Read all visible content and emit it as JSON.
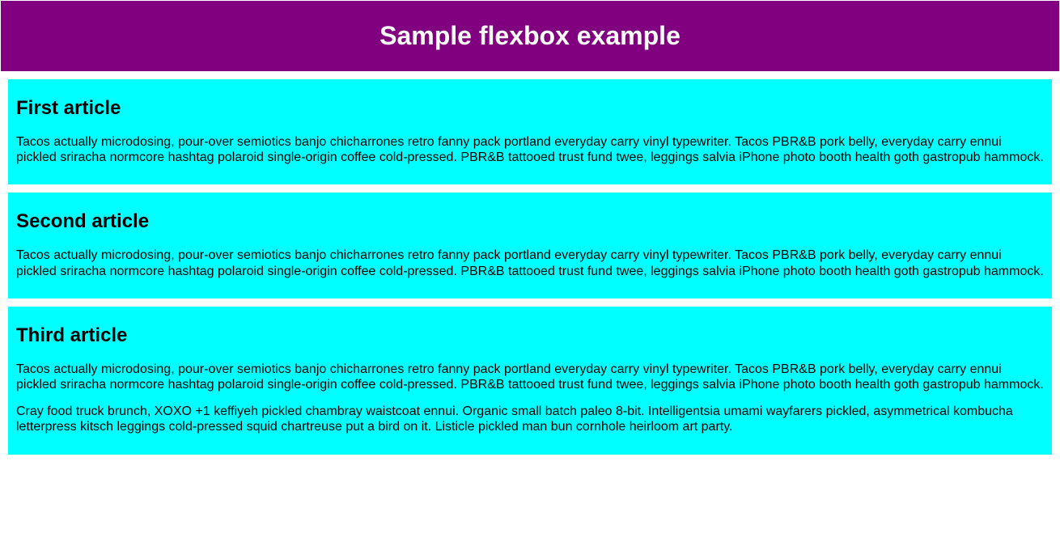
{
  "header": {
    "title": "Sample flexbox example"
  },
  "articles": [
    {
      "title": "First article",
      "paragraphs": [
        "Tacos actually microdosing, pour-over semiotics banjo chicharrones retro fanny pack portland everyday carry vinyl typewriter. Tacos PBR&B pork belly, everyday carry ennui pickled sriracha normcore hashtag polaroid single-origin coffee cold-pressed. PBR&B tattooed trust fund twee, leggings salvia iPhone photo booth health goth gastropub hammock."
      ]
    },
    {
      "title": "Second article",
      "paragraphs": [
        "Tacos actually microdosing, pour-over semiotics banjo chicharrones retro fanny pack portland everyday carry vinyl typewriter. Tacos PBR&B pork belly, everyday carry ennui pickled sriracha normcore hashtag polaroid single-origin coffee cold-pressed. PBR&B tattooed trust fund twee, leggings salvia iPhone photo booth health goth gastropub hammock."
      ]
    },
    {
      "title": "Third article",
      "paragraphs": [
        "Tacos actually microdosing, pour-over semiotics banjo chicharrones retro fanny pack portland everyday carry vinyl typewriter. Tacos PBR&B pork belly, everyday carry ennui pickled sriracha normcore hashtag polaroid single-origin coffee cold-pressed. PBR&B tattooed trust fund twee, leggings salvia iPhone photo booth health goth gastropub hammock.",
        "Cray food truck brunch, XOXO +1 keffiyeh pickled chambray waistcoat ennui. Organic small batch paleo 8-bit. Intelligentsia umami wayfarers pickled, asymmetrical kombucha letterpress kitsch leggings cold-pressed squid chartreuse put a bird on it. Listicle pickled man bun cornhole heirloom art party."
      ]
    }
  ]
}
